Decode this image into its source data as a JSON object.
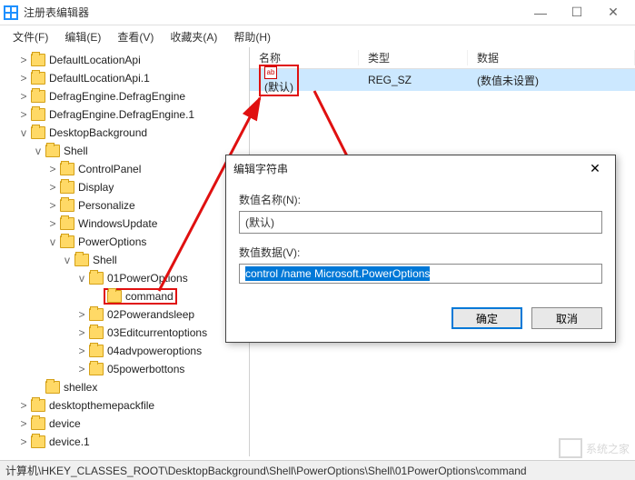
{
  "titlebar": {
    "title": "注册表编辑器"
  },
  "menubar": {
    "file": "文件(F)",
    "edit": "编辑(E)",
    "view": "查看(V)",
    "favorites": "收藏夹(A)",
    "help": "帮助(H)"
  },
  "tree": [
    {
      "indent": 1,
      "toggle": ">",
      "label": "DefaultLocationApi"
    },
    {
      "indent": 1,
      "toggle": ">",
      "label": "DefaultLocationApi.1"
    },
    {
      "indent": 1,
      "toggle": ">",
      "label": "DefragEngine.DefragEngine"
    },
    {
      "indent": 1,
      "toggle": ">",
      "label": "DefragEngine.DefragEngine.1"
    },
    {
      "indent": 1,
      "toggle": "v",
      "label": "DesktopBackground"
    },
    {
      "indent": 2,
      "toggle": "v",
      "label": "Shell"
    },
    {
      "indent": 3,
      "toggle": ">",
      "label": "ControlPanel"
    },
    {
      "indent": 3,
      "toggle": ">",
      "label": "Display"
    },
    {
      "indent": 3,
      "toggle": ">",
      "label": "Personalize"
    },
    {
      "indent": 3,
      "toggle": ">",
      "label": "WindowsUpdate"
    },
    {
      "indent": 3,
      "toggle": "v",
      "label": "PowerOptions"
    },
    {
      "indent": 4,
      "toggle": "v",
      "label": "Shell"
    },
    {
      "indent": 5,
      "toggle": "v",
      "label": "01PowerOptions"
    },
    {
      "indent": 6,
      "toggle": "",
      "label": "command",
      "highlighted": true
    },
    {
      "indent": 5,
      "toggle": ">",
      "label": "02Powerandsleep"
    },
    {
      "indent": 5,
      "toggle": ">",
      "label": "03Editcurrentoptions"
    },
    {
      "indent": 5,
      "toggle": ">",
      "label": "04advpoweroptions"
    },
    {
      "indent": 5,
      "toggle": ">",
      "label": "05powerbottons"
    },
    {
      "indent": 2,
      "toggle": "",
      "label": "shellex"
    },
    {
      "indent": 1,
      "toggle": ">",
      "label": "desktopthemepackfile"
    },
    {
      "indent": 1,
      "toggle": ">",
      "label": "device"
    },
    {
      "indent": 1,
      "toggle": ">",
      "label": "device.1"
    }
  ],
  "listHeader": {
    "name": "名称",
    "type": "类型",
    "data": "数据"
  },
  "listRow": {
    "icon": "ab",
    "name": "(默认)",
    "type": "REG_SZ",
    "data": "(数值未设置)"
  },
  "dialog": {
    "title": "编辑字符串",
    "nameLabel": "数值名称(N):",
    "nameValue": "(默认)",
    "dataLabel": "数值数据(V):",
    "dataValue": "control /name Microsoft.PowerOptions",
    "ok": "确定",
    "cancel": "取消"
  },
  "statusbar": "计算机\\HKEY_CLASSES_ROOT\\DesktopBackground\\Shell\\PowerOptions\\Shell\\01PowerOptions\\command",
  "watermark": "系统之家"
}
